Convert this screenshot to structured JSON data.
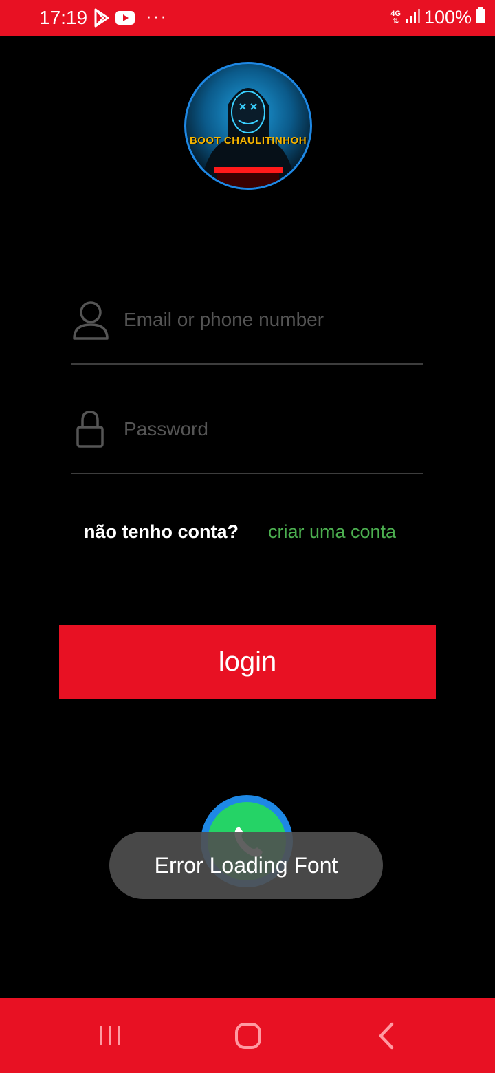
{
  "status_bar": {
    "time": "17:19",
    "network_type": "4G",
    "battery": "100%",
    "icons": [
      "play-store-icon",
      "youtube-icon",
      "more-dots-icon",
      "signal-icon",
      "battery-icon"
    ]
  },
  "logo": {
    "text": "BOOT CHAULITINHOH"
  },
  "form": {
    "email_placeholder": "Email or phone number",
    "email_value": "",
    "password_placeholder": "Password",
    "password_value": ""
  },
  "signup": {
    "question": "não tenho conta?",
    "link": "criar uma conta"
  },
  "login_button": {
    "label": "login"
  },
  "toast": {
    "message": "Error Loading Font"
  },
  "colors": {
    "brand_red": "#e81123",
    "link_green": "#4caf50",
    "whatsapp_green": "#25d366",
    "logo_blue": "#1e88e5"
  }
}
